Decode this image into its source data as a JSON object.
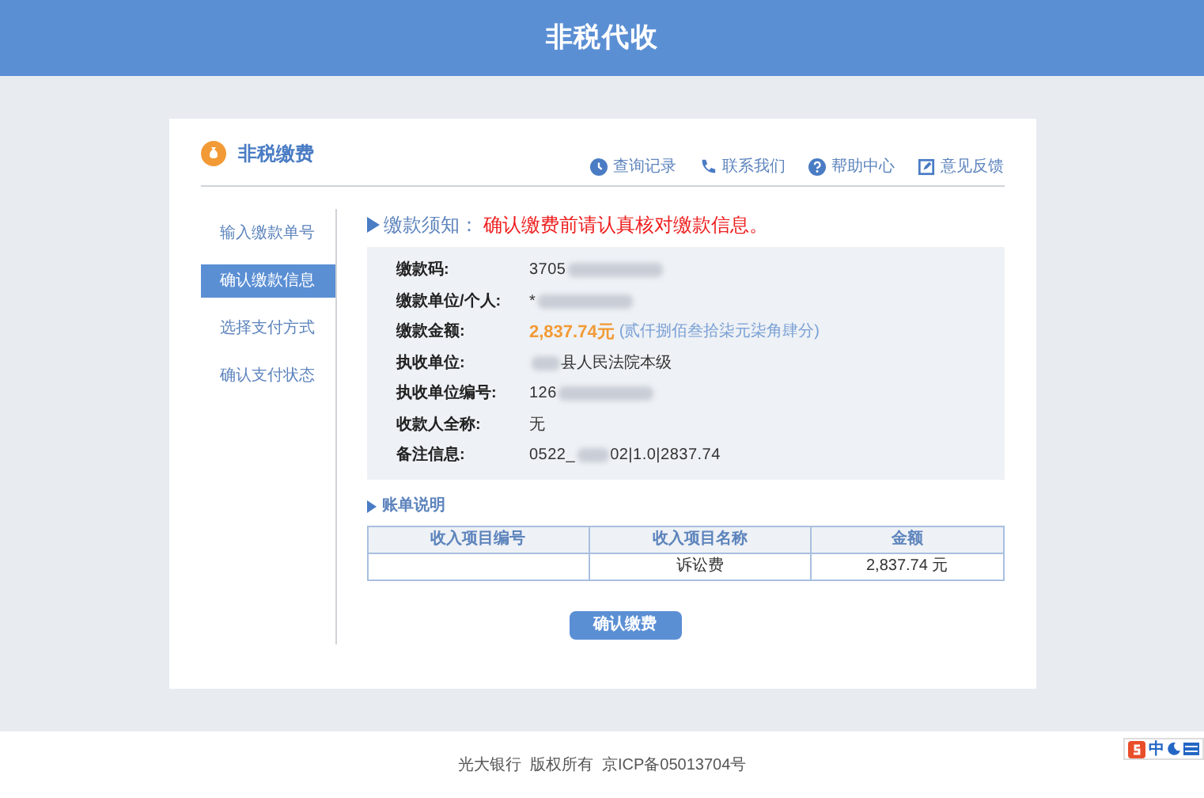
{
  "header": {
    "title": "非税代收"
  },
  "card": {
    "title": "非税缴费",
    "links": [
      {
        "label": "查询记录",
        "kind": "clock"
      },
      {
        "label": "联系我们",
        "kind": "phone"
      },
      {
        "label": "帮助中心",
        "kind": "help"
      },
      {
        "label": "意见反馈",
        "kind": "edit"
      }
    ]
  },
  "steps": [
    {
      "label": "输入缴款单号",
      "selected": false
    },
    {
      "label": "确认缴款信息",
      "selected": true
    },
    {
      "label": "选择支付方式",
      "selected": false
    },
    {
      "label": "确认支付状态",
      "selected": false
    }
  ],
  "notice": {
    "label": "缴款须知：",
    "text": "确认缴费前请认真核对缴款信息。"
  },
  "fields": [
    {
      "label": "缴款码:",
      "value": "3705",
      "blurred": true,
      "kind": "plain"
    },
    {
      "label": "缴款单位/个人:",
      "value": "*",
      "blurred": true,
      "kind": "plain"
    },
    {
      "label": "缴款金额:",
      "value": "2,837.74元",
      "note": "(贰仟捌佰叁拾柒元柒角肆分)",
      "blurred": false,
      "kind": "amount"
    },
    {
      "label": "执收单位:",
      "value": "县人民法院本级",
      "blurred": true,
      "kind": "prefix_blur"
    },
    {
      "label": "执收单位编号:",
      "value": "126",
      "blurred": true,
      "kind": "plain"
    },
    {
      "label": "收款人全称:",
      "value": "无",
      "blurred": false,
      "kind": "plain"
    },
    {
      "label": "备注信息:",
      "value": "0522_",
      "value_after": "02|1.0|2837.74",
      "blurred": true,
      "kind": "plain"
    }
  ],
  "bill": {
    "title": "账单说明",
    "columns": [
      "收入项目编号",
      "收入项目名称",
      "金额"
    ],
    "rows": [
      [
        "",
        "诉讼费",
        "2,837.74 元"
      ]
    ]
  },
  "confirm_button": "确认缴费",
  "footer": {
    "text": "光大银行  版权所有  京ICP备05013704号"
  },
  "ime_bar": {
    "label": "中"
  }
}
